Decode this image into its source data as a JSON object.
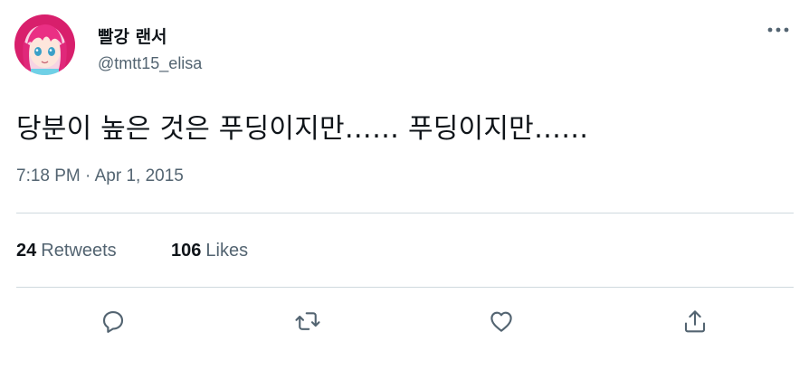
{
  "author": {
    "display_name": "빨강 랜서",
    "handle": "@tmtt15_elisa",
    "avatar_icon": "anime-girl-avatar"
  },
  "tweet": {
    "text": "당분이 높은 것은 푸딩이지만…… 푸딩이지만……",
    "time": "7:18 PM",
    "separator": "·",
    "date": "Apr 1, 2015"
  },
  "stats": {
    "retweets_count": "24",
    "retweets_label": "Retweets",
    "likes_count": "106",
    "likes_label": "Likes"
  },
  "actions": [
    {
      "name": "reply",
      "icon": "reply-icon"
    },
    {
      "name": "retweet",
      "icon": "retweet-icon"
    },
    {
      "name": "like",
      "icon": "heart-icon"
    },
    {
      "name": "share",
      "icon": "share-icon"
    }
  ],
  "colors": {
    "primary_text": "#0f1419",
    "secondary_text": "#536471",
    "divider": "#cfd9de",
    "avatar_hair": "#e0287a"
  }
}
